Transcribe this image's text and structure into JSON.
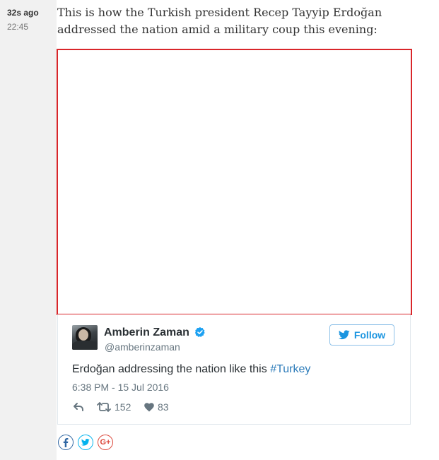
{
  "meta": {
    "time_ago": "32s ago",
    "time": "22:45"
  },
  "post": {
    "text": "This is how the Turkish president Recep Tayyip Erdoğan addressed the nation amid a military coup this evening:"
  },
  "tweet": {
    "author_name": "Amberin Zaman",
    "author_handle": "@amberinzaman",
    "follow_label": "Follow",
    "text_prefix": "Erdoğan addressing the nation like this ",
    "hashtag": "#Turkey",
    "date": "6:38 PM - 15 Jul 2016",
    "retweets": "152",
    "likes": "83"
  },
  "share": {
    "google_label": "G+"
  },
  "colors": {
    "frame_border": "#d9262a",
    "twitter_blue": "#1b95e0",
    "hashtag": "#2b7bb9",
    "facebook": "#3067a3",
    "twitter_share": "#03b3ee",
    "google": "#db4437"
  },
  "icons": {
    "verified": "verified-badge-icon",
    "follow": "twitter-bird-icon",
    "reply": "reply-icon",
    "retweet": "retweet-icon",
    "like": "heart-icon",
    "facebook": "facebook-icon",
    "twitter": "twitter-bird-icon",
    "google": "google-plus-icon"
  }
}
